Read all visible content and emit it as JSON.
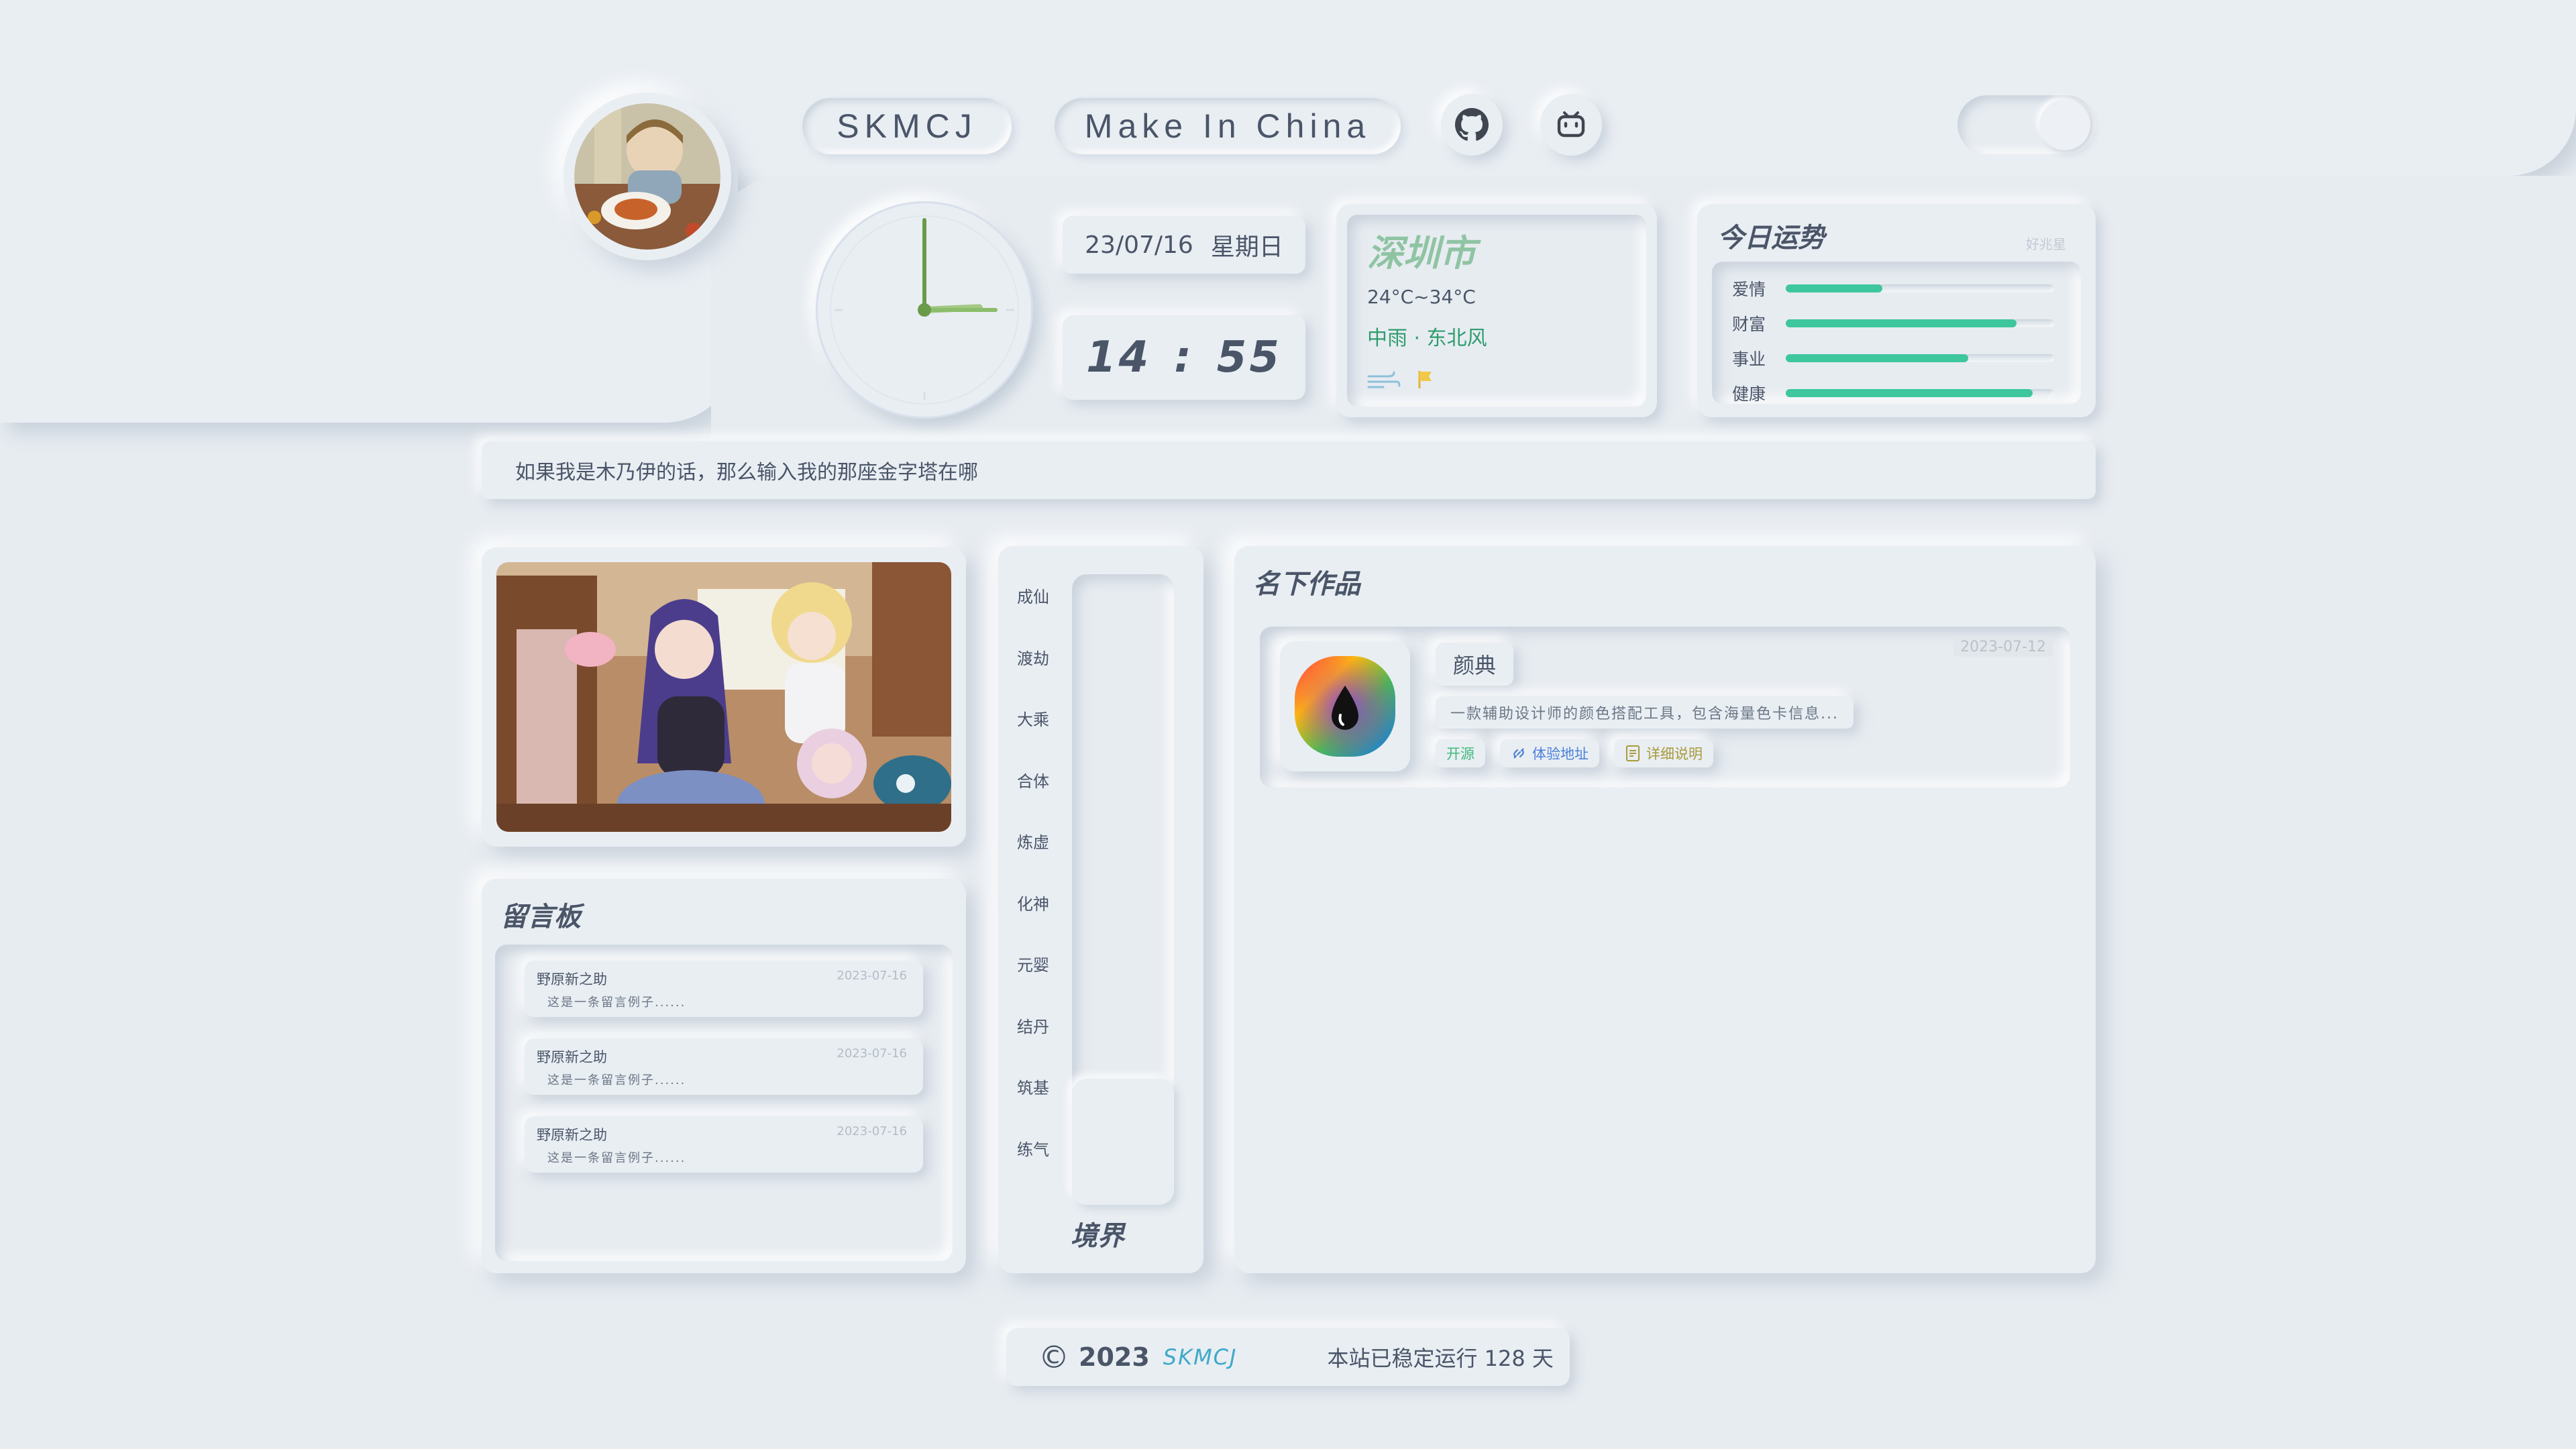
{
  "header": {
    "brand_pill": "SKMCJ",
    "slogan_pill": "Make In China",
    "icons": [
      "github-icon",
      "bilibili-icon"
    ],
    "theme_toggle_state": "on"
  },
  "clock": {
    "hour": 14,
    "minute": 55
  },
  "date": {
    "date_text": "23/07/16",
    "weekday": "星期日"
  },
  "time": {
    "hours": "14",
    "separator": ":",
    "minutes": "55"
  },
  "weather": {
    "city": "深圳市",
    "temp_range": "24°C~34°C",
    "condition": "中雨 · 东北风",
    "icons": [
      "wind-icon",
      "flag-icon"
    ]
  },
  "fortune": {
    "title": "今日运势",
    "tag": "好兆星",
    "items": [
      {
        "label": "爱情",
        "level": 0.36,
        "color": "#3ec69d"
      },
      {
        "label": "财富",
        "level": 0.86,
        "color": "#3ec69d"
      },
      {
        "label": "事业",
        "level": 0.68,
        "color": "#3ec69d"
      },
      {
        "label": "健康",
        "level": 0.92,
        "color": "#3ec69d"
      }
    ]
  },
  "quote": {
    "text": "如果我是木乃伊的话，那么输入我的那座金字塔在哪"
  },
  "messages": {
    "title": "留言板",
    "items": [
      {
        "name": "野原新之助",
        "date": "2023-07-16",
        "text": "这是一条留言例子......"
      },
      {
        "name": "野原新之助",
        "date": "2023-07-16",
        "text": "这是一条留言例子......"
      },
      {
        "name": "野原新之助",
        "date": "2023-07-16",
        "text": "这是一条留言例子......"
      }
    ]
  },
  "realm": {
    "title": "境界",
    "levels": [
      "成仙",
      "渡劫",
      "大乘",
      "合体",
      "炼虚",
      "化神",
      "元婴",
      "结丹",
      "筑基",
      "练气"
    ],
    "progress": 0.2
  },
  "works": {
    "title": "名下作品",
    "items": [
      {
        "name": "颜典",
        "date": "2023-07-12",
        "description": "一款辅助设计师的颜色搭配工具，包含海量色卡信息...",
        "tags": [
          {
            "label": "开源",
            "color": "#3fb97a",
            "icon": ""
          },
          {
            "label": "体验地址",
            "color": "#4a7fd9",
            "icon": "link-icon"
          },
          {
            "label": "详细说明",
            "color": "#a99a3a",
            "icon": "document-icon"
          }
        ]
      }
    ]
  },
  "footer": {
    "copyright_symbol": "©",
    "year": "2023",
    "signature": "SKMCJ",
    "uptime": "本站已稳定运行 128 天"
  },
  "colors": {
    "background": "#e7ecf1",
    "accent_green": "#3ec69d",
    "city_green": "#8fc4a3",
    "clock_hand": "#6a9b48",
    "clock_hand_light": "#a4c985",
    "signature_blue": "#3ea9c8"
  }
}
